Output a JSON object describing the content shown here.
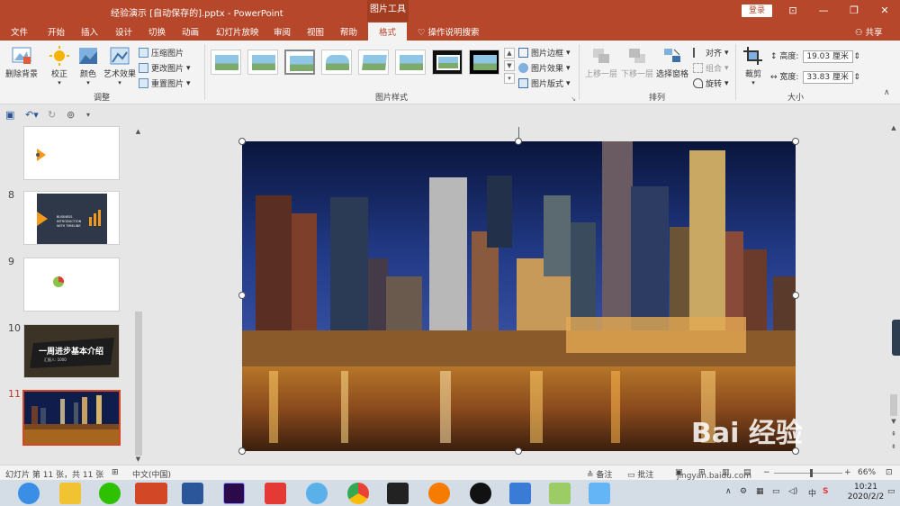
{
  "window": {
    "title": "经验演示 [自动保存的].pptx  -  PowerPoint",
    "context_group": "图片工具",
    "login": "登录",
    "restore_icon": "restore-icon",
    "minimize_icon": "minimize-icon",
    "maximize_icon": "maximize-icon",
    "close_icon": "close-icon"
  },
  "tabs": [
    "文件",
    "开始",
    "插入",
    "设计",
    "切换",
    "动画",
    "幻灯片放映",
    "审阅",
    "视图",
    "帮助",
    "格式"
  ],
  "active_tab": "格式",
  "tell_me": "操作说明搜索",
  "share": "共享",
  "ribbon": {
    "adjust": {
      "label": "调整",
      "remove_bg": "删除背景",
      "correct": "校正",
      "color": "颜色",
      "art": "艺术效果",
      "compress": "压缩图片",
      "change": "更改图片",
      "reset": "重置图片"
    },
    "styles": {
      "label": "图片样式",
      "border": "图片边框",
      "effects": "图片效果",
      "layout": "图片版式"
    },
    "arrange": {
      "label": "排列",
      "forward": "上移一层",
      "backward": "下移一层",
      "pane": "选择窗格",
      "align": "对齐",
      "group": "组合",
      "rotate": "旋转"
    },
    "size": {
      "label": "大小",
      "crop": "裁剪",
      "height_label": "高度:",
      "height_value": "19.03 厘米",
      "width_label": "宽度:",
      "width_value": "33.83 厘米"
    }
  },
  "slides": [
    {
      "num": "8",
      "caption": "BUSINESS INTRODUCTION WITH TIMELINE"
    },
    {
      "num": "9",
      "caption": ""
    },
    {
      "num": "10",
      "caption": "一周进步基本介绍",
      "subcaption": "汇报人: 1000"
    },
    {
      "num": "11",
      "caption": ""
    }
  ],
  "status": {
    "slide_info": "幻灯片 第 11 张，共 11 张",
    "language": "中文(中国)",
    "notes": "备注",
    "comments": "批注",
    "zoom": "66%"
  },
  "taskbar": {
    "time": "10:21",
    "date": "2020/2/2",
    "ime": "中"
  },
  "watermark": {
    "brand": "Bai 经验",
    "url": "jingyan.baidu.com"
  },
  "colors": {
    "accent": "#b7472a",
    "selected_border": "#d24726"
  }
}
